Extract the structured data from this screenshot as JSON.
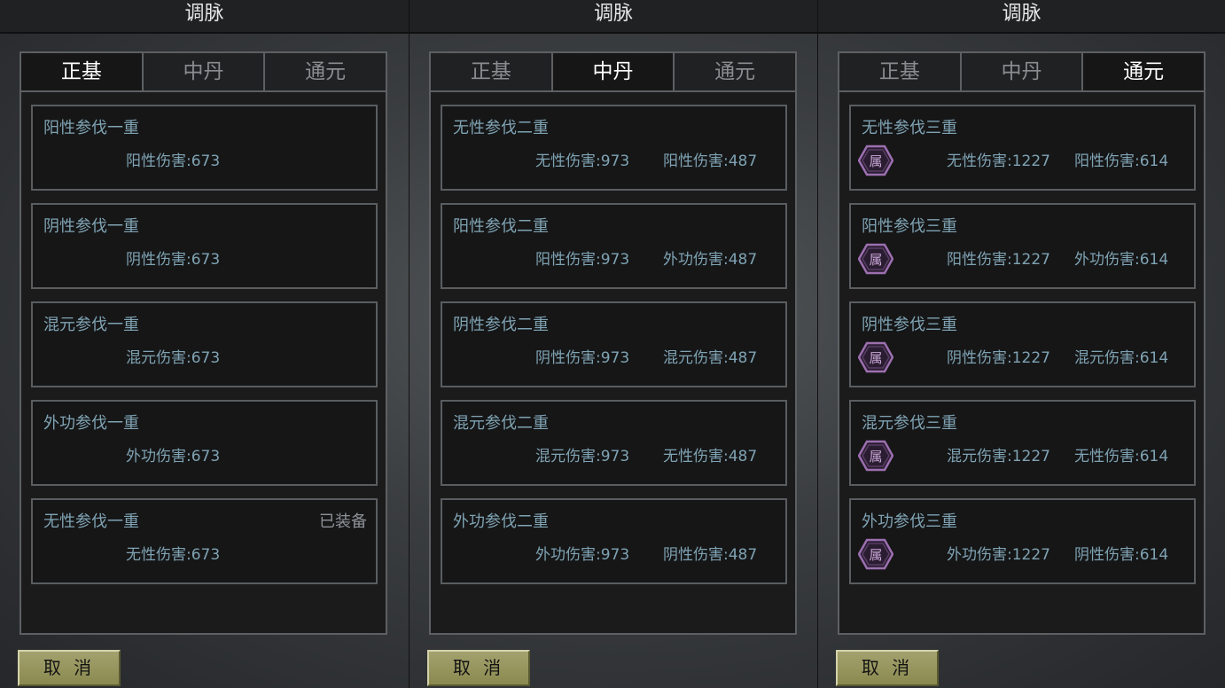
{
  "screens": [
    {
      "title": "调脉",
      "tabs": [
        "正基",
        "中丹",
        "通元"
      ],
      "active_tab": 0,
      "cancel_label": "取 消",
      "cards": [
        {
          "title": "阳性参伐一重",
          "stats": [
            "阳性伤害:673"
          ],
          "equipped": ""
        },
        {
          "title": "阴性参伐一重",
          "stats": [
            "阴性伤害:673"
          ],
          "equipped": ""
        },
        {
          "title": "混元参伐一重",
          "stats": [
            "混元伤害:673"
          ],
          "equipped": ""
        },
        {
          "title": "外功参伐一重",
          "stats": [
            "外功伤害:673"
          ],
          "equipped": ""
        },
        {
          "title": "无性参伐一重",
          "stats": [
            "无性伤害:673"
          ],
          "equipped": "已装备"
        }
      ]
    },
    {
      "title": "调脉",
      "tabs": [
        "正基",
        "中丹",
        "通元"
      ],
      "active_tab": 1,
      "cancel_label": "取 消",
      "cards": [
        {
          "title": "无性参伐二重",
          "stats": [
            "无性伤害:973",
            "阳性伤害:487"
          ],
          "equipped": ""
        },
        {
          "title": "阳性参伐二重",
          "stats": [
            "阳性伤害:973",
            "外功伤害:487"
          ],
          "equipped": ""
        },
        {
          "title": "阴性参伐二重",
          "stats": [
            "阴性伤害:973",
            "混元伤害:487"
          ],
          "equipped": ""
        },
        {
          "title": "混元参伐二重",
          "stats": [
            "混元伤害:973",
            "无性伤害:487"
          ],
          "equipped": ""
        },
        {
          "title": "外功参伐二重",
          "stats": [
            "外功伤害:973",
            "阴性伤害:487"
          ],
          "equipped": ""
        }
      ]
    },
    {
      "title": "调脉",
      "tabs": [
        "正基",
        "中丹",
        "通元"
      ],
      "active_tab": 2,
      "cancel_label": "取 消",
      "badge_label": "属",
      "cards": [
        {
          "title": "无性参伐三重",
          "stats": [
            "无性伤害:1227",
            "阳性伤害:614"
          ],
          "equipped": "",
          "badge": true
        },
        {
          "title": "阳性参伐三重",
          "stats": [
            "阳性伤害:1227",
            "外功伤害:614"
          ],
          "equipped": "",
          "badge": true
        },
        {
          "title": "阴性参伐三重",
          "stats": [
            "阴性伤害:1227",
            "混元伤害:614"
          ],
          "equipped": "",
          "badge": true
        },
        {
          "title": "混元参伐三重",
          "stats": [
            "混元伤害:1227",
            "无性伤害:614"
          ],
          "equipped": "",
          "badge": true
        },
        {
          "title": "外功参伐三重",
          "stats": [
            "外功伤害:1227",
            "阴性伤害:614"
          ],
          "equipped": "",
          "badge": true
        }
      ]
    }
  ],
  "colors": {
    "accent_text": "#7fa3b3",
    "badge_fill": "#7c4a8f",
    "cancel_button": "#9a9960"
  },
  "icons": {
    "badge": "hexagon-attribute-icon"
  }
}
